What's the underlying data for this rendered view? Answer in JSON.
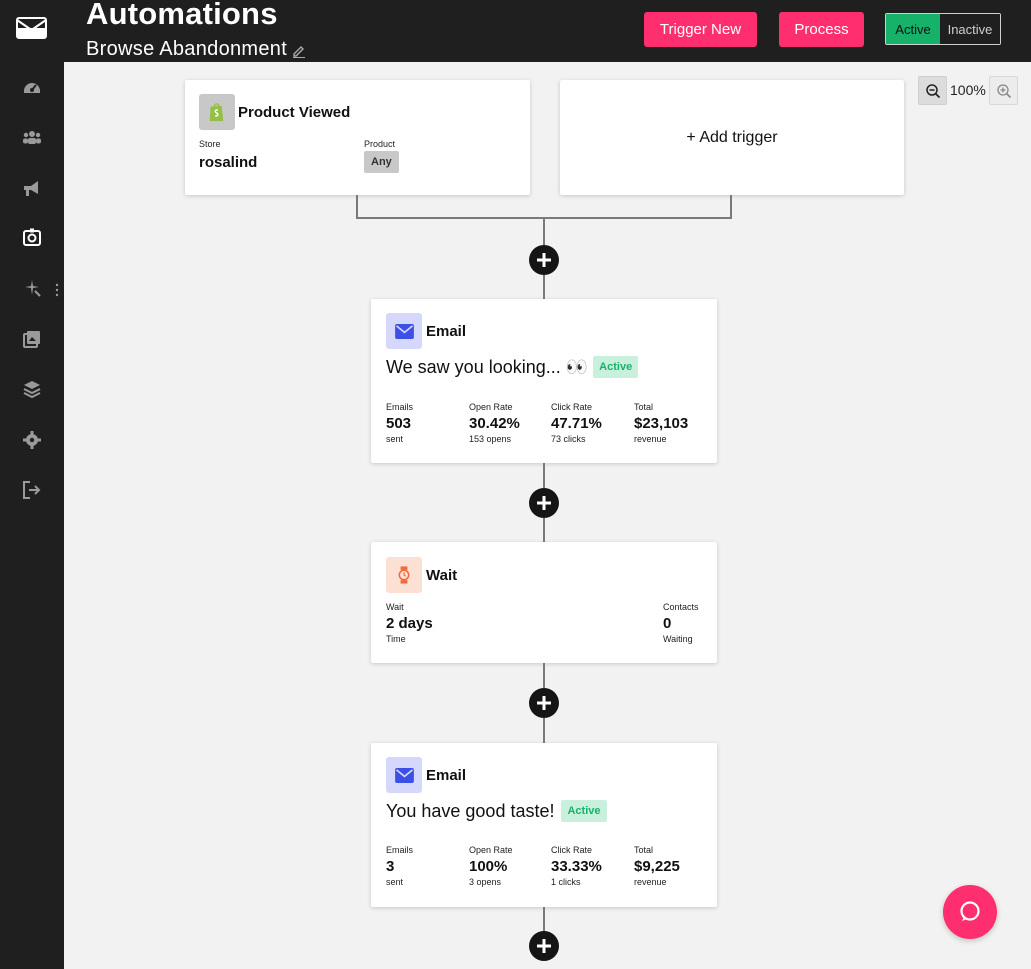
{
  "header": {
    "title": "Automations",
    "subtitle": "Browse Abandonment",
    "trigger_new_label": "Trigger New",
    "process_label": "Process",
    "toggle_active_label": "Active",
    "toggle_inactive_label": "Inactive"
  },
  "sidebar": {
    "items": [
      {
        "icon": "dashboard-icon"
      },
      {
        "icon": "users-icon"
      },
      {
        "icon": "megaphone-icon"
      },
      {
        "icon": "automation-icon",
        "active": true
      },
      {
        "icon": "sparkle-icon"
      },
      {
        "icon": "gallery-icon"
      },
      {
        "icon": "layers-icon"
      },
      {
        "icon": "gear-icon"
      },
      {
        "icon": "logout-icon"
      }
    ]
  },
  "zoom": {
    "level": "100%"
  },
  "trigger": {
    "title": "Product Viewed",
    "store_label": "Store",
    "store_value": "rosalind",
    "product_label": "Product",
    "product_value": "Any"
  },
  "add_trigger_label": "+ Add trigger",
  "steps": [
    {
      "type": "Email",
      "subject": "We saw you looking... 👀",
      "status": "Active",
      "stats": [
        {
          "label": "Emails",
          "value": "503",
          "sub": "sent"
        },
        {
          "label": "Open Rate",
          "value": "30.42%",
          "sub": "153 opens"
        },
        {
          "label": "Click Rate",
          "value": "47.71%",
          "sub": "73 clicks"
        },
        {
          "label": "Total",
          "value": "$23,103",
          "sub": "revenue"
        }
      ]
    },
    {
      "type": "Wait",
      "wait_label": "Wait",
      "wait_value": "2 days",
      "wait_sub": "Time",
      "contacts_label": "Contacts",
      "contacts_value": "0",
      "contacts_sub": "Waiting"
    },
    {
      "type": "Email",
      "subject": "You have good taste!",
      "status": "Active",
      "stats": [
        {
          "label": "Emails",
          "value": "3",
          "sub": "sent"
        },
        {
          "label": "Open Rate",
          "value": "100%",
          "sub": "3 opens"
        },
        {
          "label": "Click Rate",
          "value": "33.33%",
          "sub": "1 clicks"
        },
        {
          "label": "Total",
          "value": "$9,225",
          "sub": "revenue"
        }
      ]
    }
  ],
  "colors": {
    "accent": "#ff2e6e",
    "active_green": "#17b26a",
    "dark": "#1f1f1f"
  }
}
